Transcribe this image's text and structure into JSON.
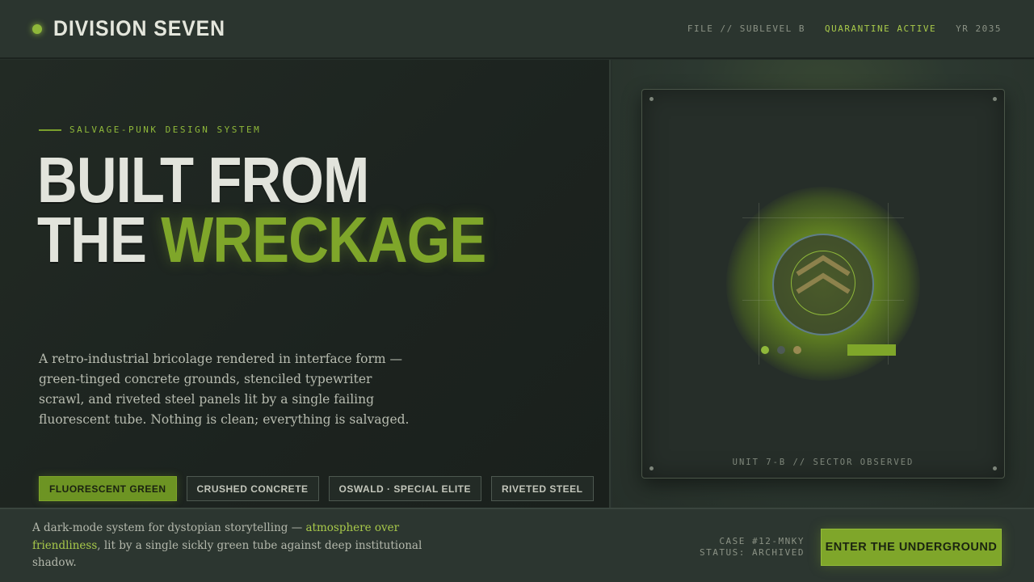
{
  "header": {
    "brand": "DIVISION SEVEN",
    "meta": [
      {
        "label": "FILE // SUBLEVEL B"
      },
      {
        "label": "QUARANTINE ACTIVE"
      },
      {
        "label": "YR 2035"
      }
    ]
  },
  "hero": {
    "eyebrow": "SALVAGE-PUNK DESIGN SYSTEM",
    "headline_line1": "BUILT FROM",
    "headline_line2_prefix": "THE ",
    "headline_line2_accent": "WRECKAGE",
    "description": "A retro-industrial bricolage rendered in interface form — green-tinged concrete grounds, stenciled typewriter scrawl, and riveted steel panels lit by a single failing fluorescent tube. Nothing is clean; everything is salvaged.",
    "tags": [
      {
        "label": "FLUORESCENT GREEN",
        "active": true
      },
      {
        "label": "CRUSHED CONCRETE",
        "active": false
      },
      {
        "label": "OSWALD · SPECIAL ELITE",
        "active": false
      },
      {
        "label": "RIVETED STEEL",
        "active": false
      }
    ]
  },
  "monitor": {
    "caption": "UNIT 7-B // SECTOR OBSERVED"
  },
  "footer": {
    "text_prefix": "A dark-mode system for dystopian storytelling — ",
    "text_highlight": "atmosphere over friendliness",
    "text_suffix": ", lit by a single sickly green tube against deep institutional shadow.",
    "case_line1": "CASE #12-MNKY",
    "case_line2": "STATUS: ARCHIVED",
    "cta_label": "ENTER THE UNDERGROUND"
  },
  "colors": {
    "accent": "#7fa62a",
    "background": "#27302b",
    "panel": "#1c231f"
  }
}
